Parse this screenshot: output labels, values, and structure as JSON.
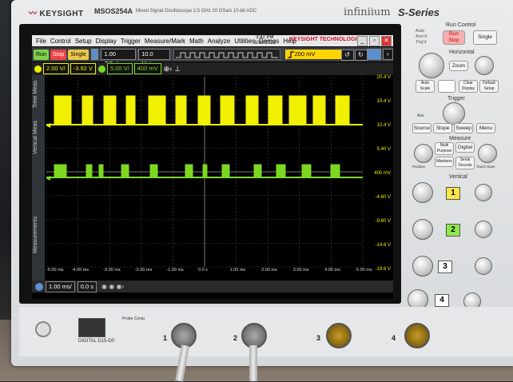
{
  "header": {
    "brand": "KEYSIGHT",
    "model": "MSOS254A",
    "model_sub": "Mixed Signal Oscilloscope   2.5 GHz   20 GSa/s   10-bit ADC",
    "product_line": "infiniium",
    "series": "S-Series"
  },
  "menubar": {
    "items": [
      "File",
      "Control",
      "Setup",
      "Display",
      "Trigger",
      "Measure/Mark",
      "Math",
      "Analyze",
      "Utilities",
      "Demos",
      "Help"
    ],
    "time": "3:42 PM",
    "date": "3/30/2022",
    "logo_text": "KEYSIGHT TECHNOLOGIES"
  },
  "toolbar": {
    "run": "Run",
    "stop": "Stop",
    "single": "Single",
    "sample_rate": "1.00 GSa/s",
    "memory_depth": "10.0 Mpts",
    "trigger_level": "200 mV"
  },
  "channels": {
    "ch1_scale": "2.00 V/",
    "ch1_offset": "-3.92 V",
    "ch2_scale": "5.00 V/",
    "ch2_offset": "400 mV",
    "ch1_color": "#f0f000",
    "ch2_color": "#7dd820"
  },
  "side_tabs": [
    "Time Meas",
    "Vertical Meas",
    "Measurements"
  ],
  "right_scale": [
    "20.4 V",
    "15.4 V",
    "10.4 V",
    "5.40 V",
    "400 mV",
    "-4.60 V",
    "-9.60 V",
    "-14.6 V",
    "-19.6 V"
  ],
  "bottom_scale": [
    "-5.00 ms",
    "-4.00 ms",
    "-3.00 ms",
    "-2.00 ms",
    "-1.00 ms",
    "0.0 s",
    "1.00 ms",
    "2.00 ms",
    "3.00 ms",
    "4.00 ms",
    "5.00 ms"
  ],
  "statusbar": {
    "timebase": "1.00 ms/",
    "delay": "0.0 s"
  },
  "panel": {
    "run_control": "Run Control",
    "run_stop": "Run Stop",
    "single": "Single",
    "auto": "Auto",
    "armd": "Arm'd",
    "trigd": "Trig'd",
    "horizontal": "Horizontal",
    "zoom": "Zoom",
    "auto_scale": "Auto Scale",
    "clear_display": "Clear Display",
    "default_setup": "Default Setup",
    "trigger": "Trigger",
    "source": "Source",
    "slope": "Slope",
    "sweep": "Sweep",
    "menu": "Menu",
    "aux": "Aux",
    "measure": "Measure",
    "multi_purpose": "Multi Purpose",
    "digital": "Digital",
    "markers": "Markers",
    "serial_decode": "Serial Decode",
    "position": "Position",
    "touch_save": "Touch Save",
    "vertical": "Vertical",
    "ch_numbers": [
      "1",
      "2",
      "3",
      "4"
    ]
  },
  "front": {
    "digital": "DIGITAL D15-D0",
    "probe_comp": "Probe Comp",
    "ch_labels": [
      "1",
      "2",
      "3",
      "4"
    ]
  }
}
